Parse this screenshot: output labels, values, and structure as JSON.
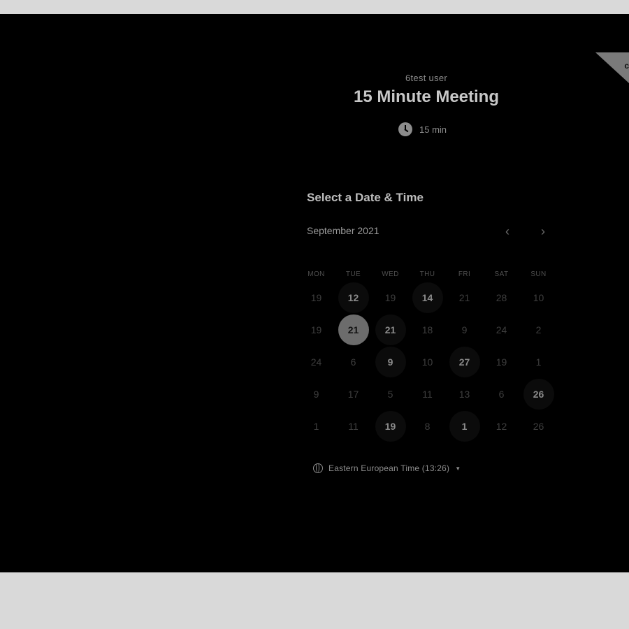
{
  "corner_badge": {
    "text": "c"
  },
  "event": {
    "organizer": "6test user",
    "title": "15 Minute Meeting",
    "duration": "15 min",
    "duration_icon": "clock-icon"
  },
  "calendar": {
    "heading": "Select a Date & Time",
    "month": "September 2021",
    "weekdays": [
      "MON",
      "TUE",
      "WED",
      "THU",
      "FRI",
      "SAT",
      "SUN"
    ],
    "rows": [
      [
        {
          "d": "19",
          "s": "off"
        },
        {
          "d": "12",
          "s": "available"
        },
        {
          "d": "19",
          "s": "off"
        },
        {
          "d": "14",
          "s": "available"
        },
        {
          "d": "21",
          "s": "off"
        },
        {
          "d": "28",
          "s": "off"
        },
        {
          "d": "10",
          "s": "off"
        }
      ],
      [
        {
          "d": "19",
          "s": "off"
        },
        {
          "d": "21",
          "s": "selected"
        },
        {
          "d": "21",
          "s": "available"
        },
        {
          "d": "18",
          "s": "off"
        },
        {
          "d": "9",
          "s": "off"
        },
        {
          "d": "24",
          "s": "off"
        },
        {
          "d": "2",
          "s": "off"
        }
      ],
      [
        {
          "d": "24",
          "s": "off"
        },
        {
          "d": "6",
          "s": "off"
        },
        {
          "d": "9",
          "s": "available"
        },
        {
          "d": "10",
          "s": "off"
        },
        {
          "d": "27",
          "s": "available"
        },
        {
          "d": "19",
          "s": "off"
        },
        {
          "d": "1",
          "s": "off"
        }
      ],
      [
        {
          "d": "9",
          "s": "off"
        },
        {
          "d": "17",
          "s": "off"
        },
        {
          "d": "5",
          "s": "off"
        },
        {
          "d": "11",
          "s": "off"
        },
        {
          "d": "13",
          "s": "off"
        },
        {
          "d": "6",
          "s": "off"
        },
        {
          "d": "26",
          "s": "available"
        }
      ],
      [
        {
          "d": "1",
          "s": "off"
        },
        {
          "d": "11",
          "s": "off"
        },
        {
          "d": "19",
          "s": "available"
        },
        {
          "d": "8",
          "s": "off"
        },
        {
          "d": "1",
          "s": "available"
        },
        {
          "d": "12",
          "s": "off"
        },
        {
          "d": "26",
          "s": "off"
        }
      ]
    ]
  },
  "timezone": {
    "label": "Eastern European Time (13:26)",
    "icon": "globe-icon"
  }
}
